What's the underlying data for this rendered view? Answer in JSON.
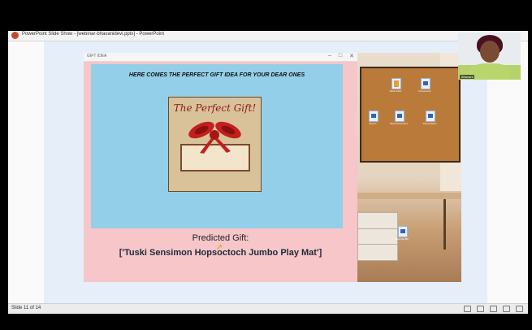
{
  "powerpoint": {
    "window_title": "PowerPoint Slide Show - [webinar-bhavanidevi.pptx] - PowerPoint",
    "status_slide": "Slide 11 of 14"
  },
  "gift_app": {
    "window_title": "GIFT IDEA",
    "controls": [
      "–",
      "□",
      "✕"
    ],
    "heading": "HERE COMES THE PERFECT GIFT IDEA FOR YOUR DEAR ONES",
    "card_title": "The Perfect Gift!",
    "predicted_label": "Predicted Gift:",
    "predicted_value": "['Tuski Sensimon Hopsoctoch Jumbo Play Mat']"
  },
  "webcam": {
    "participant_name": "Bhavani"
  },
  "desktop_icons": [
    {
      "label": "Stock Files"
    },
    {
      "label": "Documents"
    },
    {
      "label": "Report"
    },
    {
      "label": "Word Document"
    },
    {
      "label": "Presentation"
    },
    {
      "label": "Recycle Bin"
    }
  ],
  "colors": {
    "panel_blue": "#94cfe9",
    "window_pink": "#f6c6c9",
    "cork": "#b97a3a",
    "ribbon_red": "#c21f1f"
  }
}
